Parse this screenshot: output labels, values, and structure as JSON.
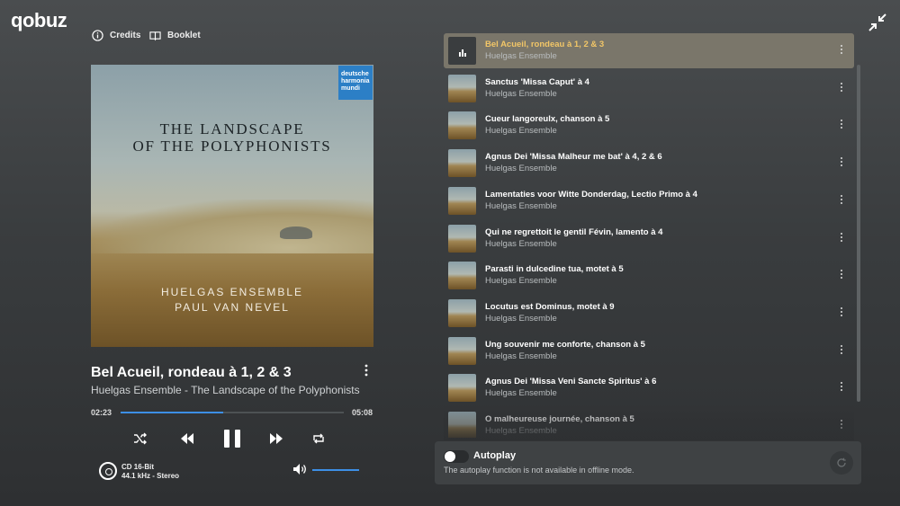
{
  "app": {
    "logo": "qobuz"
  },
  "top_buttons": {
    "credits": "Credits",
    "booklet": "Booklet"
  },
  "cover": {
    "title_line1": "THE LANDSCAPE",
    "title_line2": "OF THE POLYPHONISTS",
    "artist_line1": "HUELGAS ENSEMBLE",
    "artist_line2": "PAUL VAN NEVEL",
    "label_l1": "deutsche",
    "label_l2": "harmonia",
    "label_l3": "mundi"
  },
  "now_playing": {
    "title": "Bel Acueil, rondeau à 1, 2 & 3",
    "subtitle": "Huelgas Ensemble - The Landscape of the Polyphonists",
    "elapsed": "02:23",
    "duration": "05:08",
    "progress_percent": 46
  },
  "quality": {
    "line1": "CD 16-Bit",
    "line2": "44.1 kHz - Stereo"
  },
  "volume": {
    "level_percent": 100
  },
  "queue": [
    {
      "title": "Bel Acueil, rondeau à 1, 2 & 3",
      "artist": "Huelgas Ensemble",
      "active": true
    },
    {
      "title": "Sanctus 'Missa Caput' à 4",
      "artist": "Huelgas Ensemble"
    },
    {
      "title": "Cueur langoreulx, chanson à 5",
      "artist": "Huelgas Ensemble"
    },
    {
      "title": "Agnus Dei 'Missa Malheur me bat' à 4, 2 & 6",
      "artist": "Huelgas Ensemble"
    },
    {
      "title": "Lamentaties voor Witte Donderdag, Lectio Primo à 4",
      "artist": "Huelgas Ensemble"
    },
    {
      "title": "Qui ne regrettoit le gentil Févin, lamento à 4",
      "artist": "Huelgas Ensemble"
    },
    {
      "title": "Parasti in dulcedine tua, motet à 5",
      "artist": "Huelgas Ensemble"
    },
    {
      "title": "Locutus est Dominus, motet à 9",
      "artist": "Huelgas Ensemble"
    },
    {
      "title": "Ung souvenir me conforte, chanson à 5",
      "artist": "Huelgas Ensemble"
    },
    {
      "title": "Agnus Dei 'Missa Veni Sancte Spiritus' à 6",
      "artist": "Huelgas Ensemble"
    },
    {
      "title": "O malheureuse journée, chanson à 5",
      "artist": "Huelgas Ensemble"
    }
  ],
  "autoplay": {
    "title": "Autoplay",
    "description": "The autoplay function is not available in offline mode."
  },
  "colors": {
    "accent": "#3d8fe6",
    "active_title": "#f2c667"
  }
}
